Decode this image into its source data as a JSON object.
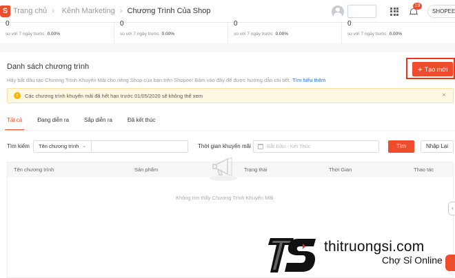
{
  "breadcrumb": {
    "home": "Trang chủ",
    "marketing": "Kênh Marketing",
    "current": "Chương Trình Của Shop"
  },
  "header": {
    "notification_count": "19",
    "shop_name": "SHOPEE U"
  },
  "stats": [
    {
      "value": "0",
      "compare_label": "so với 7 ngày trước",
      "compare_value": "0.00%"
    },
    {
      "value": "0",
      "compare_label": "so với 7 ngày trước",
      "compare_value": "0.00%"
    },
    {
      "value": "0",
      "compare_label": "so với 7 ngày trước",
      "compare_value": "0.00%"
    },
    {
      "value": "0",
      "compare_label": "so với 7 ngày trước",
      "compare_value": "0.00%"
    }
  ],
  "panel": {
    "title": "Danh sách chương trình",
    "description": "Hãy bắt đầu tạo Chương Trình Khuyến Mãi cho riêng Shop của bạn trên Shopee! Bấm vào đây để được hướng dẫn chi tiết.",
    "learn_more": "Tìm hiểu thêm",
    "create_label": "Tạo mới",
    "notice": "Các chương trình khuyến mãi đã hết hạn trước 01/05/2020 sẽ không thể xem"
  },
  "tabs": [
    {
      "label": "Tất cả",
      "active": true
    },
    {
      "label": "Đang diễn ra",
      "active": false
    },
    {
      "label": "Sắp diễn ra",
      "active": false
    },
    {
      "label": "Đã kết thúc",
      "active": false
    }
  ],
  "filters": {
    "search_label": "Tìm kiếm",
    "search_field": "Tên chương trình",
    "time_label": "Thời gian khuyến mãi",
    "date_placeholder": "Bắt Đầu - Kết Thúc",
    "find_label": "Tìm",
    "reset_label": "Nhập Lại"
  },
  "table": {
    "columns": [
      "Tên chương trình",
      "Sản phẩm",
      "Trạng thái",
      "Thời Gian",
      "Thao tác"
    ],
    "empty_text": "Không tìm thấy Chương Trình Khuyến Mãi"
  },
  "watermark": {
    "domain": "thitruongsi.com",
    "slogan": "Chợ Sỉ Online"
  },
  "colors": {
    "accent": "#ee4d2d",
    "link": "#2673dd",
    "notice_bg": "#fff8e3"
  }
}
